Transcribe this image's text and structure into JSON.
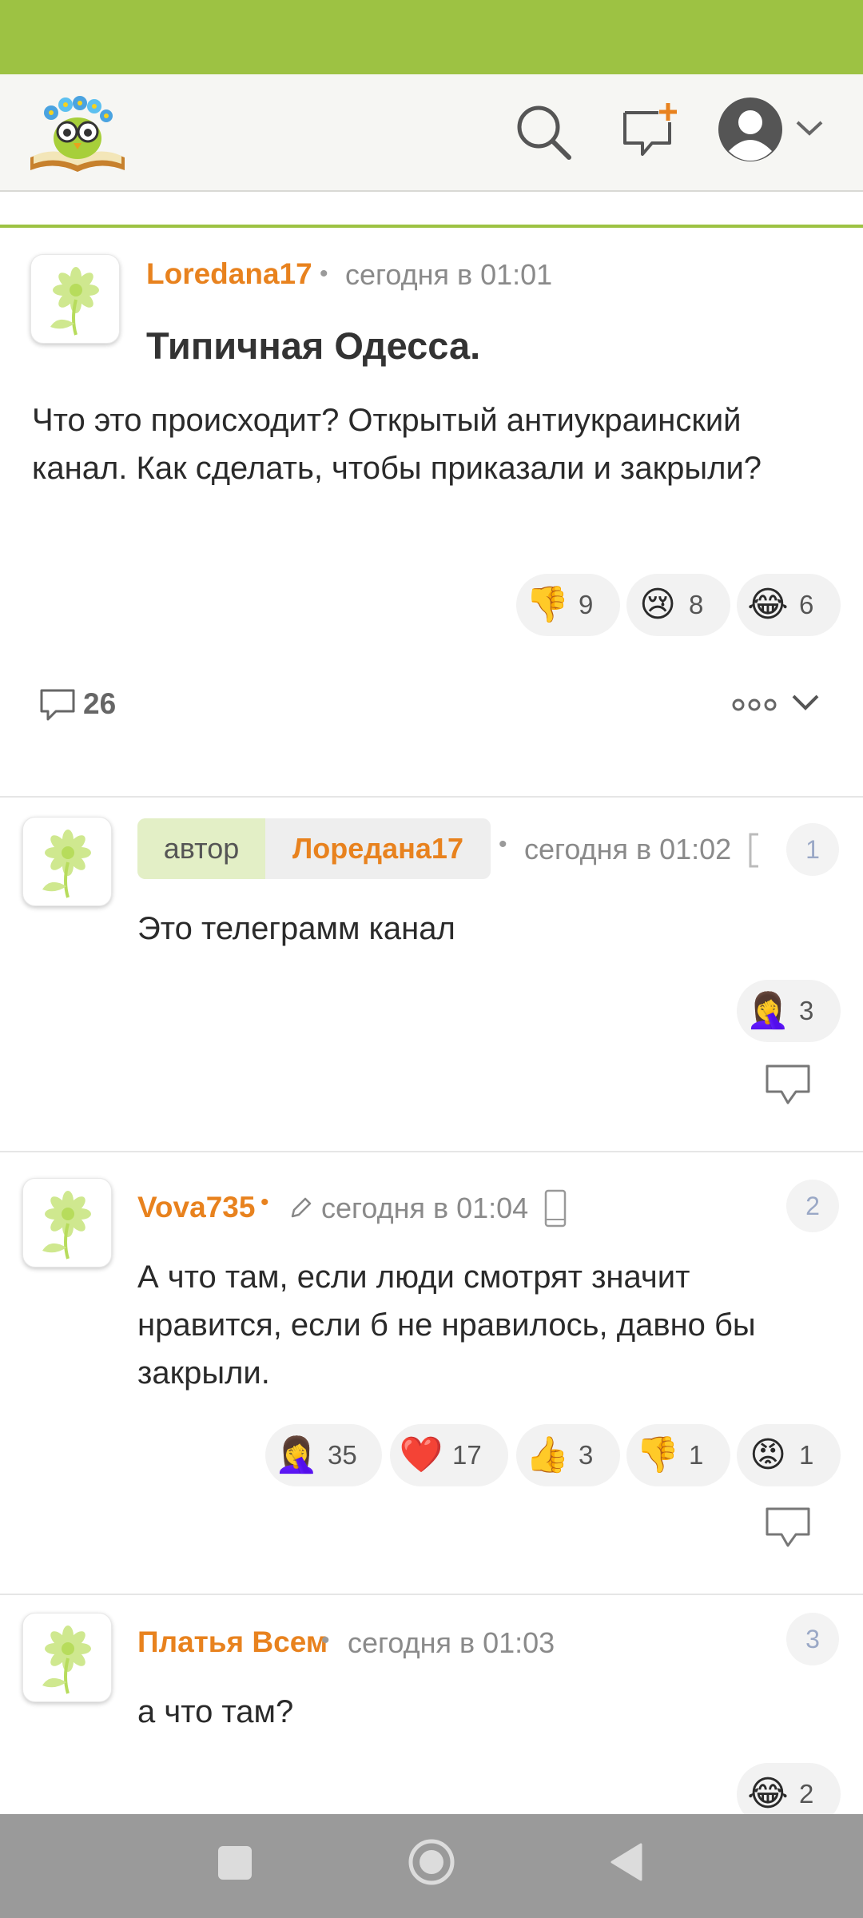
{
  "header": {
    "logo": "owl-on-book-logo",
    "icons": [
      "search-icon",
      "new-post-icon",
      "user-avatar-icon",
      "chevron-down-icon"
    ]
  },
  "post": {
    "author": "Loredana17",
    "time": "сегодня в 01:01",
    "title": "Типичная Одесса.",
    "body": "Что это происходит? Открытый антиукраинский канал. Как сделать, чтобы приказали и закрыли?",
    "reactions": [
      {
        "emoji": "👎",
        "icon": "thumbs-down-icon",
        "count": "9"
      },
      {
        "emoji": "😢",
        "icon": "crying-face-icon",
        "count": "8"
      },
      {
        "emoji": "😂",
        "icon": "tears-of-joy-icon",
        "count": "6"
      }
    ],
    "comments_count": "26"
  },
  "comments": [
    {
      "role": "автор",
      "author": "Лоредана17",
      "time": "сегодня в 01:02",
      "number": "1",
      "text": "Это телеграмм канал",
      "reactions": [
        {
          "emoji": "🤦‍♀️",
          "icon": "facepalm-icon",
          "count": "3"
        }
      ]
    },
    {
      "author": "Vova735",
      "time": "сегодня в 01:04",
      "number": "2",
      "text": "А что там, если люди смотрят значит нравится, если б не нравилось, давно бы закрыли.",
      "reactions": [
        {
          "emoji": "🤦‍♀️",
          "icon": "facepalm-icon",
          "count": "35"
        },
        {
          "emoji": "❤️",
          "icon": "heart-icon",
          "count": "17"
        },
        {
          "emoji": "👍",
          "icon": "thumbs-up-icon",
          "count": "3"
        },
        {
          "emoji": "👎",
          "icon": "thumbs-down-icon",
          "count": "1"
        },
        {
          "emoji": "😡",
          "icon": "angry-face-icon",
          "count": "1"
        }
      ]
    },
    {
      "author": "Платья Всем",
      "time": "сегодня в 01:03",
      "number": "3",
      "text": "а что там?",
      "reactions": [
        {
          "emoji": "😂",
          "icon": "tears-of-joy-icon",
          "count": "2"
        }
      ]
    }
  ],
  "colors": {
    "status_bar": "#9dc243",
    "accent_orange": "#e8821e",
    "author_badge": "#e3efc6",
    "nav_bar": "#9a9a9a"
  },
  "nav": [
    "recent-apps-icon",
    "home-icon",
    "back-icon"
  ]
}
